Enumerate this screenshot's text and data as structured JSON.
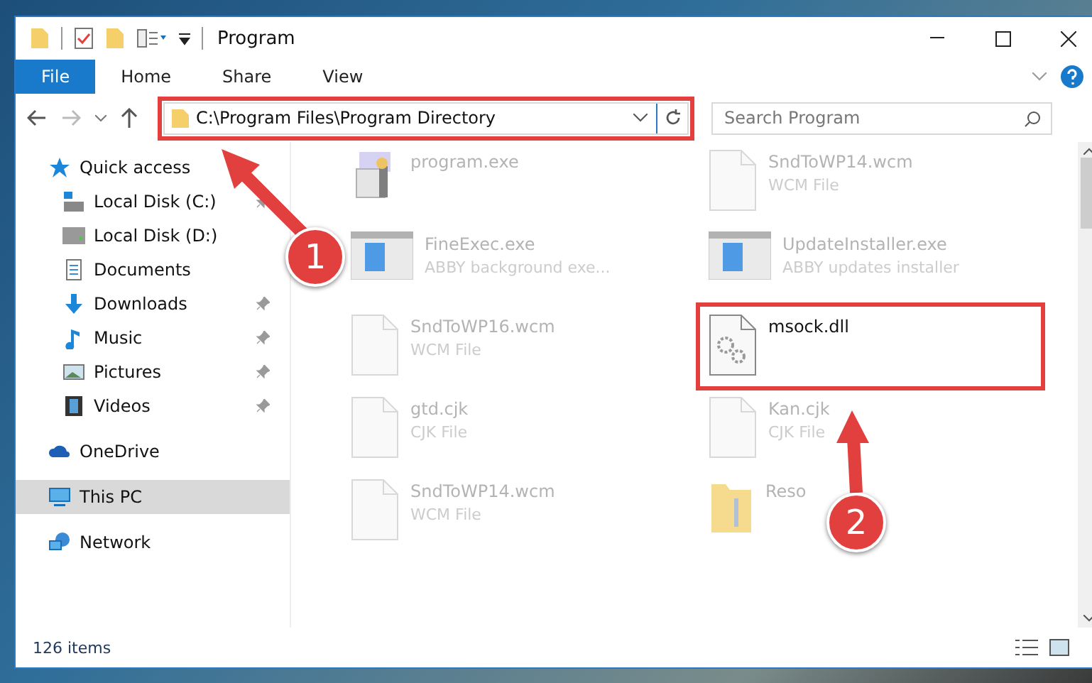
{
  "window": {
    "title": "Program"
  },
  "ribbon": {
    "tabs": [
      {
        "label": "File",
        "selected": true
      },
      {
        "label": "Home",
        "selected": false
      },
      {
        "label": "Share",
        "selected": false
      },
      {
        "label": "View",
        "selected": false
      }
    ]
  },
  "address": {
    "path": "C:\\Program Files\\Program Directory",
    "marked": true
  },
  "search": {
    "placeholder": "Search Program"
  },
  "sidebar": {
    "items": [
      {
        "label": "Quick access",
        "kind": "star",
        "pinned": false,
        "selected": false,
        "children": [
          {
            "label": "Local Disk (C:)",
            "kind": "disk-c",
            "pinned": true,
            "selected": false
          },
          {
            "label": "Local Disk (D:)",
            "kind": "disk",
            "pinned": false,
            "selected": false
          },
          {
            "label": "Documents",
            "kind": "documents",
            "pinned": false,
            "selected": false
          },
          {
            "label": "Downloads",
            "kind": "downloads",
            "pinned": true,
            "selected": false
          },
          {
            "label": "Music",
            "kind": "music",
            "pinned": true,
            "selected": false
          },
          {
            "label": "Pictures",
            "kind": "pictures",
            "pinned": true,
            "selected": false
          },
          {
            "label": "Videos",
            "kind": "videos",
            "pinned": true,
            "selected": false
          }
        ]
      },
      {
        "label": "OneDrive",
        "kind": "cloud",
        "pinned": false,
        "selected": false
      },
      {
        "label": "This PC",
        "kind": "pc",
        "pinned": false,
        "selected": true
      },
      {
        "label": "Network",
        "kind": "network",
        "pinned": false,
        "selected": false
      }
    ]
  },
  "files": [
    {
      "name": "program.exe",
      "kind": "setup",
      "faded": true,
      "marked": false
    },
    {
      "name": "SndToWP14.wcm",
      "description": "WCM File",
      "kind": "blank",
      "faded": true,
      "marked": false
    },
    {
      "name": "FineExec.exe",
      "description": "ABBY background exe...",
      "kind": "app",
      "faded": true,
      "marked": false
    },
    {
      "name": "UpdateInstaller.exe",
      "description": "ABBY updates installer",
      "kind": "app",
      "faded": true,
      "marked": false
    },
    {
      "name": "SndToWP16.wcm",
      "description": "WCM File",
      "kind": "blank",
      "faded": true,
      "marked": false
    },
    {
      "name": "msock.dll",
      "kind": "dll",
      "faded": false,
      "marked": true
    },
    {
      "name": "gtd.cjk",
      "description": "CJK File",
      "kind": "blank",
      "faded": true,
      "marked": false
    },
    {
      "name": "Kan.cjk",
      "description": "CJK File",
      "kind": "blank",
      "faded": true,
      "marked": false
    },
    {
      "name": "SndToWP14.wcm",
      "description": "WCM File",
      "kind": "blank",
      "faded": true,
      "marked": false
    },
    {
      "name": "Reso",
      "kind": "folder",
      "faded": true,
      "marked": false
    }
  ],
  "status_bar": {
    "count": "126 items"
  },
  "callouts": [
    {
      "number": "1"
    },
    {
      "number": "2"
    }
  ]
}
